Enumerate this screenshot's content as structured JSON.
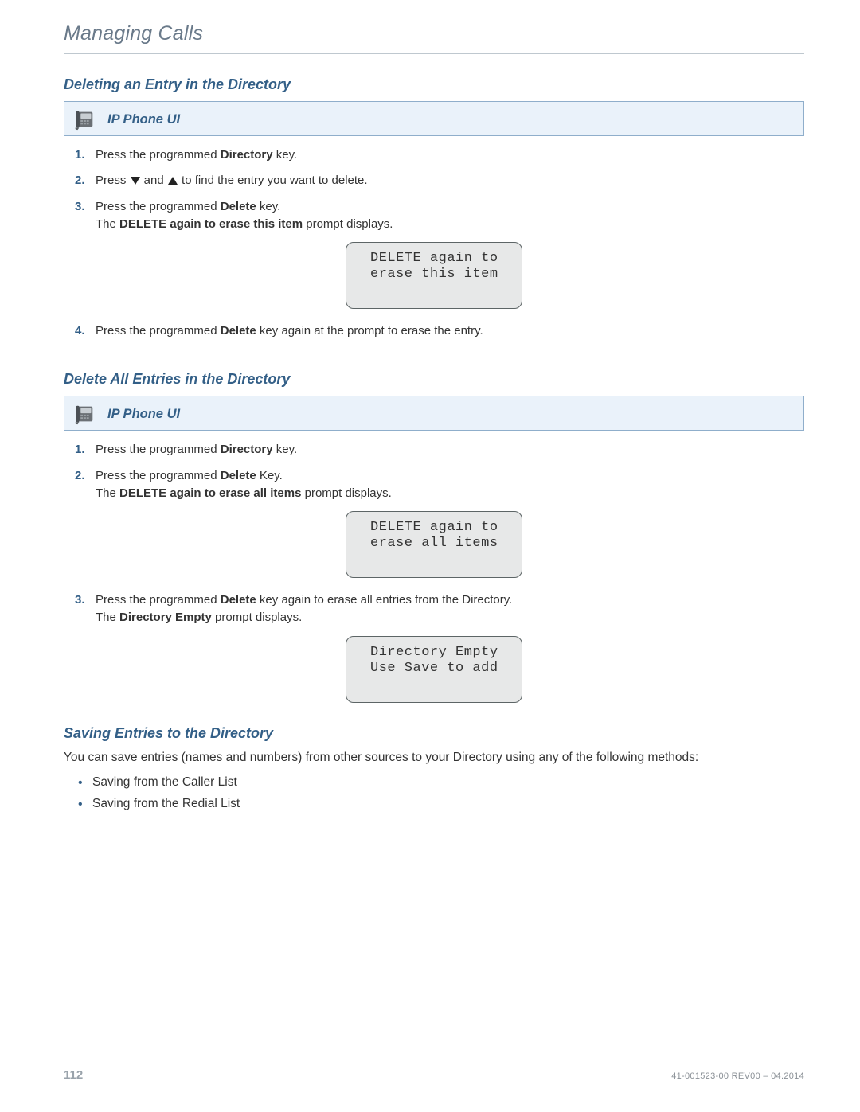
{
  "chapter": "Managing Calls",
  "sections": {
    "del_entry": {
      "title": "Deleting an Entry in the Directory",
      "box_label": "IP Phone UI",
      "step1_a": "Press the programmed ",
      "step1_b": "Directory",
      "step1_c": " key.",
      "step2_a": "Press ",
      "step2_b": " and ",
      "step2_c": " to find the entry you want to delete.",
      "step3_a": "Press the programmed ",
      "step3_b": "Delete",
      "step3_c": " key.",
      "step3_sub_a": "The ",
      "step3_sub_b": "DELETE again to erase this item",
      "step3_sub_c": " prompt displays.",
      "lcd1": "DELETE again to\nerase this item",
      "step4_a": "Press the programmed ",
      "step4_b": "Delete",
      "step4_c": " key again at the prompt to erase the entry."
    },
    "del_all": {
      "title": "Delete All Entries in the Directory",
      "box_label": "IP Phone UI",
      "step1_a": "Press the programmed ",
      "step1_b": "Directory",
      "step1_c": " key.",
      "step2_a": "Press the programmed ",
      "step2_b": "Delete",
      "step2_c": " Key.",
      "step2_sub_a": "The ",
      "step2_sub_b": "DELETE again to erase all items",
      "step2_sub_c": " prompt displays.",
      "lcd1": "DELETE again to\nerase all items",
      "step3_a": "Press the programmed ",
      "step3_b": "Delete",
      "step3_c": " key again to erase all entries from the Directory.",
      "step3_sub_a": "The ",
      "step3_sub_b": "Directory Empty",
      "step3_sub_c": " prompt displays.",
      "lcd2": "Directory Empty\nUse Save to add"
    },
    "saving": {
      "title": "Saving Entries to the Directory",
      "intro": "You can save entries (names and numbers) from other sources to your Directory using any of the following methods:",
      "bullets": [
        "Saving from the Caller List",
        "Saving from the Redial List"
      ]
    }
  },
  "footer": {
    "page": "112",
    "rev": "41-001523-00 REV00 – 04.2014"
  }
}
